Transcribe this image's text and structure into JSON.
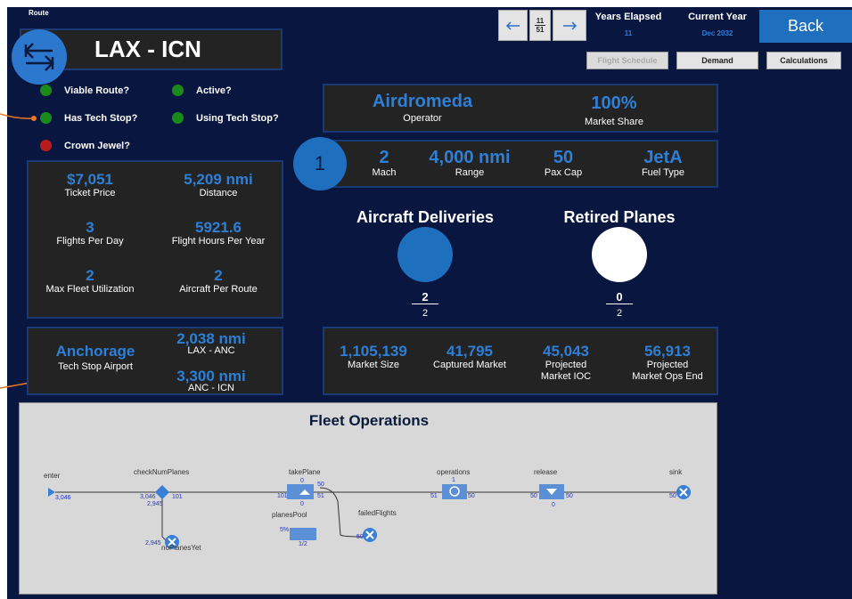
{
  "header": {
    "route_caption": "Route",
    "route_name": "LAX - ICN",
    "year_index": "11",
    "year_total": "51",
    "years_elapsed_label": "Years Elapsed",
    "years_elapsed_value": "11",
    "current_year_label": "Current Year",
    "current_year_value": "Dec 2032",
    "back_label": "Back"
  },
  "buttons": {
    "flight_schedule": "Flight Schedule",
    "demand": "Demand",
    "calculations": "Calculations"
  },
  "flags": [
    {
      "label": "Viable Route?",
      "color": "#1a8a1a"
    },
    {
      "label": "Active?",
      "color": "#1a8a1a"
    },
    {
      "label": "Has Tech Stop?",
      "color": "#1a8a1a"
    },
    {
      "label": "Using Tech Stop?",
      "color": "#1a8a1a"
    },
    {
      "label": "Crown Jewel?",
      "color": "#b81b1b"
    }
  ],
  "route_stats": [
    {
      "value": "$7,051",
      "label": "Ticket Price"
    },
    {
      "value": "5,209 nmi",
      "label": "Distance"
    },
    {
      "value": "3",
      "label": "Flights Per Day"
    },
    {
      "value": "5921.6",
      "label": "Flight Hours Per Year"
    },
    {
      "value": "2",
      "label": "Max Fleet Utilization"
    },
    {
      "value": "2",
      "label": "Aircraft Per Route"
    }
  ],
  "tech_stop": {
    "airport": "Anchorage",
    "airport_label": "Tech Stop Airport",
    "leg1_distance": "2,038 nmi",
    "leg1_label": "LAX - ANC",
    "leg2_distance": "3,300 nmi",
    "leg2_label": "ANC - ICN"
  },
  "operator": {
    "name": "Airdromeda",
    "name_label": "Operator",
    "share": "100%",
    "share_label": "Market Share"
  },
  "aircraft": {
    "index": "1",
    "specs": [
      {
        "value": "2",
        "label": "Mach"
      },
      {
        "value": "4,000 nmi",
        "label": "Range"
      },
      {
        "value": "50",
        "label": "Pax Cap"
      },
      {
        "value": "JetA",
        "label": "Fuel Type"
      }
    ]
  },
  "deliveries": {
    "title": "Aircraft Deliveries",
    "numerator": "2",
    "denominator": "2",
    "fill": 1.0,
    "color": "#1f6fbf"
  },
  "retired": {
    "title": "Retired Planes",
    "numerator": "0",
    "denominator": "2",
    "fill": 0.0,
    "color": "#ffffff"
  },
  "market": [
    {
      "value": "1,105,139",
      "label": "Market Size"
    },
    {
      "value": "41,795",
      "label": "Captured Market"
    },
    {
      "value": "45,043",
      "label": "Projected Market IOC"
    },
    {
      "value": "56,913",
      "label": "Projected Market Ops End"
    }
  ],
  "fleet_ops": {
    "title": "Fleet Operations",
    "nodes": {
      "enter": "enter",
      "check": "checkNumPlanes",
      "take": "takePlane",
      "operations": "operations",
      "release": "release",
      "sink": "sink",
      "pool": "planesPool",
      "failed": "failedFlights",
      "noplanes": "noPlanesYet"
    },
    "counts": {
      "enter_out": "3,046",
      "check_in": "3,046",
      "check_out": "101",
      "check_down": "2,945",
      "noplanes_in": "2,945",
      "take_in": "101",
      "take_top": "0",
      "take_right": "51",
      "take_fail": "50",
      "take_bottom": "0",
      "ops_top": "1",
      "ops_in": "51",
      "ops_out": "50",
      "rel_in": "50",
      "rel_out": "50",
      "rel_bottom": "0",
      "sink_in": "50",
      "failed_in": "50",
      "pool_pct": "5%",
      "pool_frac": "1/2"
    }
  },
  "colors": {
    "background": "#081640",
    "accent": "#2e7fd6",
    "panel": "#232324",
    "back_button": "#1f6fbf"
  }
}
